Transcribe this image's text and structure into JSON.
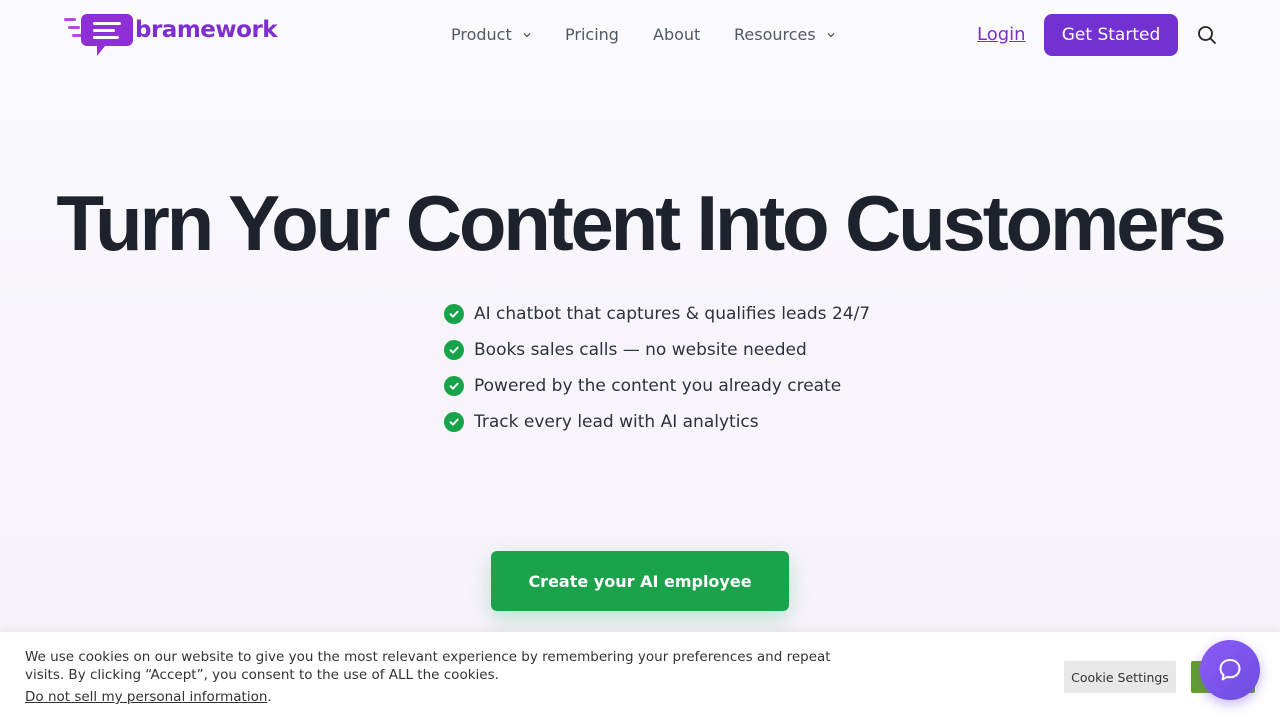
{
  "brand": {
    "name": "bramework",
    "color": "#7d2fd0"
  },
  "nav": {
    "items": [
      {
        "label": "Product",
        "has_dropdown": true
      },
      {
        "label": "Pricing",
        "has_dropdown": false
      },
      {
        "label": "About",
        "has_dropdown": false
      },
      {
        "label": "Resources",
        "has_dropdown": true
      }
    ],
    "login_label": "Login",
    "cta_label": "Get Started",
    "search_icon": "search-icon"
  },
  "hero": {
    "title": "Turn Your Content Into Customers",
    "features": [
      "AI chatbot that captures & qualifies leads 24/7",
      "Books sales calls — no website needed",
      "Powered by the content you already create",
      "Track every lead with AI analytics"
    ],
    "cta_label": "Create your AI employee",
    "cta_color": "#1aa34b"
  },
  "cookie": {
    "text": "We use cookies on our website to give you the most relevant experience by remembering your preferences and repeat visits. By clicking “Accept”, you consent to the use of ALL the cookies.",
    "link_label": "Do not sell my personal information",
    "link_suffix": ".",
    "settings_label": "Cookie Settings"
  },
  "chat": {
    "icon": "chat-icon"
  }
}
